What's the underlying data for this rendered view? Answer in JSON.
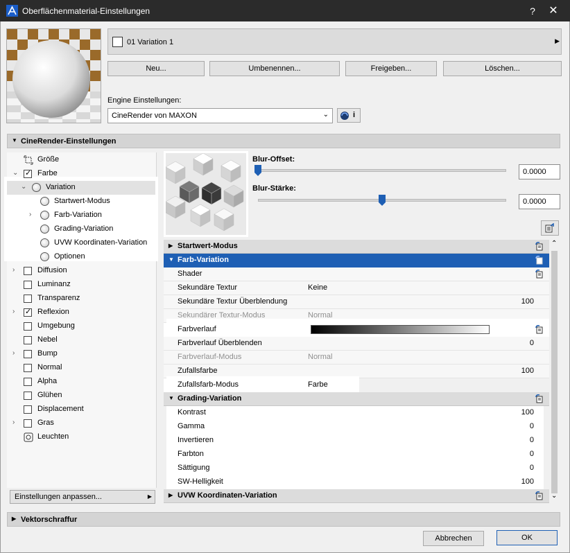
{
  "window": {
    "title": "Oberflächenmaterial-Einstellungen",
    "help_label": "?",
    "close_label": "✕"
  },
  "variation_selector": {
    "label": "01 Variation 1",
    "arrow": "▶"
  },
  "buttons": {
    "new": "Neu...",
    "rename": "Umbenennen...",
    "release": "Freigeben...",
    "delete": "Löschen..."
  },
  "engine": {
    "label": "Engine Einstellungen:",
    "value": "CineRender von MAXON",
    "info_label": "i"
  },
  "sections": {
    "cinerender": "CineRender-Einstellungen",
    "vector": "Vektorschraffur"
  },
  "tree": [
    {
      "label": "Größe",
      "type": "size-icon",
      "exp": ""
    },
    {
      "label": "Farbe",
      "type": "checkbox",
      "checked": true,
      "exp": "v"
    },
    {
      "label": "Variation",
      "type": "radio",
      "exp": "v",
      "indent": 1
    },
    {
      "label": "Startwert-Modus",
      "type": "radio",
      "exp": "",
      "indent": 2
    },
    {
      "label": "Farb-Variation",
      "type": "radio",
      "exp": ">",
      "indent": 2
    },
    {
      "label": "Grading-Variation",
      "type": "radio",
      "exp": "",
      "indent": 2
    },
    {
      "label": "UVW Koordinaten-Variation",
      "type": "radio",
      "exp": "",
      "indent": 2
    },
    {
      "label": "Optionen",
      "type": "radio",
      "exp": "",
      "indent": 2
    },
    {
      "label": "Diffusion",
      "type": "checkbox",
      "checked": false,
      "exp": ">"
    },
    {
      "label": "Luminanz",
      "type": "checkbox",
      "checked": false,
      "exp": ""
    },
    {
      "label": "Transparenz",
      "type": "checkbox",
      "checked": false,
      "exp": ""
    },
    {
      "label": "Reflexion",
      "type": "checkbox",
      "checked": true,
      "exp": ">"
    },
    {
      "label": "Umgebung",
      "type": "checkbox",
      "checked": false,
      "exp": ""
    },
    {
      "label": "Nebel",
      "type": "checkbox",
      "checked": false,
      "exp": ""
    },
    {
      "label": "Bump",
      "type": "checkbox",
      "checked": false,
      "exp": ">"
    },
    {
      "label": "Normal",
      "type": "checkbox",
      "checked": false,
      "exp": ""
    },
    {
      "label": "Alpha",
      "type": "checkbox",
      "checked": false,
      "exp": ""
    },
    {
      "label": "Glühen",
      "type": "checkbox",
      "checked": false,
      "exp": ""
    },
    {
      "label": "Displacement",
      "type": "checkbox",
      "checked": false,
      "exp": ""
    },
    {
      "label": "Gras",
      "type": "checkbox",
      "checked": false,
      "exp": ">"
    },
    {
      "label": "Leuchten",
      "type": "light-icon",
      "exp": ""
    }
  ],
  "customize_label": "Einstellungen anpassen...",
  "blur_offset": {
    "label": "Blur-Offset:",
    "value": "0.0000",
    "level": 0.0
  },
  "blur_strength": {
    "label": "Blur-Stärke:",
    "value": "0.0000",
    "level": 0.5
  },
  "props": {
    "startwert": "Startwert-Modus",
    "farbvar": "Farb-Variation",
    "shader": "Shader",
    "sek_textur": "Sekundäre Textur",
    "sek_textur_val": "Keine",
    "sek_ueber": "Sekundäre Textur Überblendung",
    "sek_ueber_val": "100",
    "sek_modus": "Sekundärer Textur-Modus",
    "sek_modus_val": "Normal",
    "farbverlauf": "Farbverlauf",
    "fv_ueber": "Farbverlauf Überblenden",
    "fv_ueber_val": "0",
    "fv_modus": "Farbverlauf-Modus",
    "fv_modus_val": "Normal",
    "zufall": "Zufallsfarbe",
    "zufall_val": "100",
    "zufall_modus": "Zufallsfarb-Modus",
    "zufall_modus_val": "Farbe",
    "grading": "Grading-Variation",
    "kontrast": "Kontrast",
    "kontrast_val": "100",
    "gamma": "Gamma",
    "gamma_val": "0",
    "invert": "Invertieren",
    "invert_val": "0",
    "farbton": "Farbton",
    "farbton_val": "0",
    "saett": "Sättigung",
    "saett_val": "0",
    "sw": "SW-Helligkeit",
    "sw_val": "100",
    "uvw": "UVW Koordinaten-Variation"
  },
  "footer": {
    "cancel": "Abbrechen",
    "ok": "OK"
  }
}
